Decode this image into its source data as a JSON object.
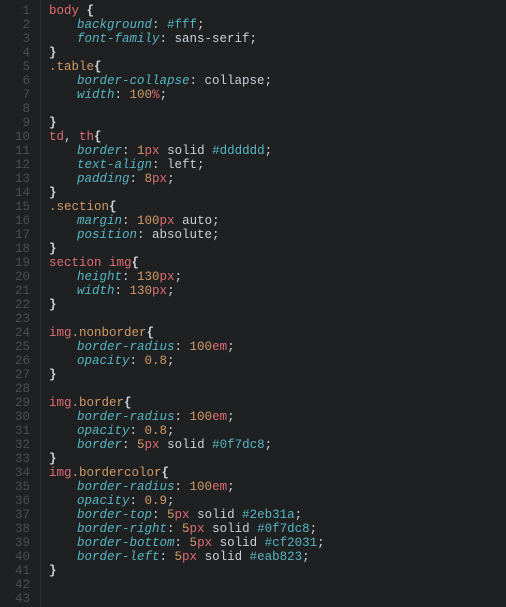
{
  "language": "css",
  "colors": {
    "bg": "#1e2021",
    "gutter_fg": "#4b4e4f",
    "selector": "#e06c75",
    "class_selector": "#d19a66",
    "property": "#56b6c2",
    "number": "#d19a66",
    "unit": "#e06c75",
    "hex": "#56b6c2",
    "text": "#c9d1d9"
  },
  "lines": [
    {
      "n": "1",
      "indent": 0,
      "tok": [
        [
          "sel",
          "body"
        ],
        [
          "brace",
          " {"
        ]
      ]
    },
    {
      "n": "2",
      "indent": 1,
      "tok": [
        [
          "prop",
          "background"
        ],
        [
          "punc",
          ": "
        ],
        [
          "hex",
          "#fff"
        ],
        [
          "punc",
          ";"
        ]
      ]
    },
    {
      "n": "3",
      "indent": 1,
      "tok": [
        [
          "prop",
          "font-family"
        ],
        [
          "punc",
          ": "
        ],
        [
          "val",
          "sans-serif"
        ],
        [
          "punc",
          ";"
        ]
      ]
    },
    {
      "n": "4",
      "indent": 0,
      "tok": [
        [
          "brace",
          "}"
        ]
      ]
    },
    {
      "n": "5",
      "indent": 0,
      "tok": [
        [
          "sel-class",
          ".table"
        ],
        [
          "brace",
          "{"
        ]
      ]
    },
    {
      "n": "6",
      "indent": 1,
      "tok": [
        [
          "prop",
          "border-collapse"
        ],
        [
          "punc",
          ": "
        ],
        [
          "val",
          "collapse"
        ],
        [
          "punc",
          ";"
        ]
      ]
    },
    {
      "n": "7",
      "indent": 1,
      "tok": [
        [
          "prop",
          "width"
        ],
        [
          "punc",
          ": "
        ],
        [
          "num",
          "100"
        ],
        [
          "unit",
          "%"
        ],
        [
          "punc",
          ";"
        ]
      ]
    },
    {
      "n": "8",
      "indent": 0,
      "tok": []
    },
    {
      "n": "9",
      "indent": 0,
      "tok": [
        [
          "brace",
          "}"
        ]
      ]
    },
    {
      "n": "10",
      "indent": 0,
      "tok": [
        [
          "sel",
          "td"
        ],
        [
          "punc",
          ", "
        ],
        [
          "sel",
          "th"
        ],
        [
          "brace",
          "{"
        ]
      ]
    },
    {
      "n": "11",
      "indent": 1,
      "tok": [
        [
          "prop",
          "border"
        ],
        [
          "punc",
          ": "
        ],
        [
          "num",
          "1"
        ],
        [
          "unit",
          "px"
        ],
        [
          "val",
          " solid "
        ],
        [
          "hex",
          "#dddddd"
        ],
        [
          "punc",
          ";"
        ]
      ]
    },
    {
      "n": "12",
      "indent": 1,
      "tok": [
        [
          "prop",
          "text-align"
        ],
        [
          "punc",
          ": "
        ],
        [
          "val",
          "left"
        ],
        [
          "punc",
          ";"
        ]
      ]
    },
    {
      "n": "13",
      "indent": 1,
      "tok": [
        [
          "prop",
          "padding"
        ],
        [
          "punc",
          ": "
        ],
        [
          "num",
          "8"
        ],
        [
          "unit",
          "px"
        ],
        [
          "punc",
          ";"
        ]
      ]
    },
    {
      "n": "14",
      "indent": 0,
      "tok": [
        [
          "brace",
          "}"
        ]
      ]
    },
    {
      "n": "15",
      "indent": 0,
      "tok": [
        [
          "sel-class",
          ".section"
        ],
        [
          "brace",
          "{"
        ]
      ]
    },
    {
      "n": "16",
      "indent": 1,
      "tok": [
        [
          "prop",
          "margin"
        ],
        [
          "punc",
          ": "
        ],
        [
          "num",
          "100"
        ],
        [
          "unit",
          "px"
        ],
        [
          "val",
          " auto"
        ],
        [
          "punc",
          ";"
        ]
      ]
    },
    {
      "n": "17",
      "indent": 1,
      "tok": [
        [
          "prop",
          "position"
        ],
        [
          "punc",
          ": "
        ],
        [
          "val",
          "absolute"
        ],
        [
          "punc",
          ";"
        ]
      ]
    },
    {
      "n": "18",
      "indent": 0,
      "tok": [
        [
          "brace",
          "}"
        ]
      ]
    },
    {
      "n": "19",
      "indent": 0,
      "tok": [
        [
          "sel",
          "section "
        ],
        [
          "sel",
          "img"
        ],
        [
          "brace",
          "{"
        ]
      ]
    },
    {
      "n": "20",
      "indent": 1,
      "tok": [
        [
          "prop",
          "height"
        ],
        [
          "punc",
          ": "
        ],
        [
          "num",
          "130"
        ],
        [
          "unit",
          "px"
        ],
        [
          "punc",
          ";"
        ]
      ]
    },
    {
      "n": "21",
      "indent": 1,
      "tok": [
        [
          "prop",
          "width"
        ],
        [
          "punc",
          ": "
        ],
        [
          "num",
          "130"
        ],
        [
          "unit",
          "px"
        ],
        [
          "punc",
          ";"
        ]
      ]
    },
    {
      "n": "22",
      "indent": 0,
      "tok": [
        [
          "brace",
          "}"
        ]
      ]
    },
    {
      "n": "23",
      "indent": 0,
      "tok": []
    },
    {
      "n": "24",
      "indent": 0,
      "tok": [
        [
          "sel",
          "img"
        ],
        [
          "sel-class",
          ".nonborder"
        ],
        [
          "brace",
          "{"
        ]
      ]
    },
    {
      "n": "25",
      "indent": 1,
      "tok": [
        [
          "prop",
          "border-radius"
        ],
        [
          "punc",
          ": "
        ],
        [
          "num",
          "100"
        ],
        [
          "unit",
          "em"
        ],
        [
          "punc",
          ";"
        ]
      ]
    },
    {
      "n": "26",
      "indent": 1,
      "tok": [
        [
          "prop",
          "opacity"
        ],
        [
          "punc",
          ": "
        ],
        [
          "num",
          "0.8"
        ],
        [
          "punc",
          ";"
        ]
      ]
    },
    {
      "n": "27",
      "indent": 0,
      "tok": [
        [
          "brace",
          "}"
        ]
      ]
    },
    {
      "n": "28",
      "indent": 0,
      "tok": []
    },
    {
      "n": "29",
      "indent": 0,
      "tok": [
        [
          "sel",
          "img"
        ],
        [
          "sel-class",
          ".border"
        ],
        [
          "brace",
          "{"
        ]
      ]
    },
    {
      "n": "30",
      "indent": 1,
      "tok": [
        [
          "prop",
          "border-radius"
        ],
        [
          "punc",
          ": "
        ],
        [
          "num",
          "100"
        ],
        [
          "unit",
          "em"
        ],
        [
          "punc",
          ";"
        ]
      ]
    },
    {
      "n": "31",
      "indent": 1,
      "tok": [
        [
          "prop",
          "opacity"
        ],
        [
          "punc",
          ": "
        ],
        [
          "num",
          "0.8"
        ],
        [
          "punc",
          ";"
        ]
      ]
    },
    {
      "n": "32",
      "indent": 1,
      "tok": [
        [
          "prop",
          "border"
        ],
        [
          "punc",
          ": "
        ],
        [
          "num",
          "5"
        ],
        [
          "unit",
          "px"
        ],
        [
          "val",
          " solid "
        ],
        [
          "hex",
          "#0f7dc8"
        ],
        [
          "punc",
          ";"
        ]
      ]
    },
    {
      "n": "33",
      "indent": 0,
      "tok": [
        [
          "brace",
          "}"
        ]
      ]
    },
    {
      "n": "34",
      "indent": 0,
      "tok": [
        [
          "sel",
          "img"
        ],
        [
          "sel-class",
          ".bordercolor"
        ],
        [
          "brace",
          "{"
        ]
      ]
    },
    {
      "n": "35",
      "indent": 1,
      "tok": [
        [
          "prop",
          "border-radius"
        ],
        [
          "punc",
          ": "
        ],
        [
          "num",
          "100"
        ],
        [
          "unit",
          "em"
        ],
        [
          "punc",
          ";"
        ]
      ]
    },
    {
      "n": "36",
      "indent": 1,
      "tok": [
        [
          "prop",
          "opacity"
        ],
        [
          "punc",
          ": "
        ],
        [
          "num",
          "0.9"
        ],
        [
          "punc",
          ";"
        ]
      ]
    },
    {
      "n": "37",
      "indent": 1,
      "tok": [
        [
          "prop",
          "border-top"
        ],
        [
          "punc",
          ": "
        ],
        [
          "num",
          "5"
        ],
        [
          "unit",
          "px"
        ],
        [
          "val",
          " solid "
        ],
        [
          "hex",
          "#2eb31a"
        ],
        [
          "punc",
          ";"
        ]
      ]
    },
    {
      "n": "38",
      "indent": 1,
      "tok": [
        [
          "prop",
          "border-right"
        ],
        [
          "punc",
          ": "
        ],
        [
          "num",
          "5"
        ],
        [
          "unit",
          "px"
        ],
        [
          "val",
          " solid "
        ],
        [
          "hex",
          "#0f7dc8"
        ],
        [
          "punc",
          ";"
        ]
      ]
    },
    {
      "n": "39",
      "indent": 1,
      "tok": [
        [
          "prop",
          "border-bottom"
        ],
        [
          "punc",
          ": "
        ],
        [
          "num",
          "5"
        ],
        [
          "unit",
          "px"
        ],
        [
          "val",
          " solid "
        ],
        [
          "hex",
          "#cf2031"
        ],
        [
          "punc",
          ";"
        ]
      ]
    },
    {
      "n": "40",
      "indent": 1,
      "tok": [
        [
          "prop",
          "border-left"
        ],
        [
          "punc",
          ": "
        ],
        [
          "num",
          "5"
        ],
        [
          "unit",
          "px"
        ],
        [
          "val",
          " solid "
        ],
        [
          "hex",
          "#eab823"
        ],
        [
          "punc",
          ";"
        ]
      ]
    },
    {
      "n": "41",
      "indent": 0,
      "tok": [
        [
          "brace",
          "}"
        ]
      ]
    },
    {
      "n": "42",
      "indent": 0,
      "tok": []
    },
    {
      "n": "43",
      "indent": 0,
      "tok": []
    }
  ]
}
